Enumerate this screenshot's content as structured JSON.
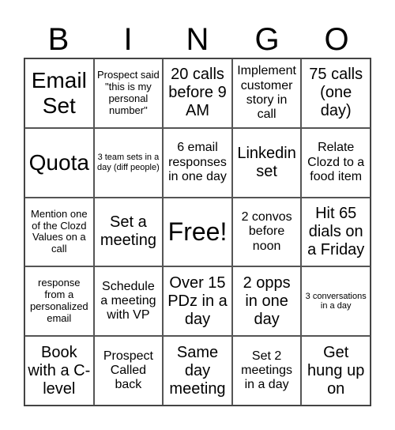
{
  "header": {
    "letters": [
      "B",
      "I",
      "N",
      "G",
      "O"
    ]
  },
  "cells": [
    {
      "text": "Email Set",
      "size": "xl"
    },
    {
      "text": "Prospect said \"this is my personal number\"",
      "size": "s"
    },
    {
      "text": "20 calls before 9 AM",
      "size": "l"
    },
    {
      "text": "Implement customer story in call",
      "size": "m"
    },
    {
      "text": "75 calls (one day)",
      "size": "l"
    },
    {
      "text": "Quota",
      "size": "xl"
    },
    {
      "text": "3 team sets in a day (diff people)",
      "size": "xs"
    },
    {
      "text": "6 email responses in one day",
      "size": "m"
    },
    {
      "text": "Linkedin set",
      "size": "l"
    },
    {
      "text": "Relate Clozd to a food item",
      "size": "m"
    },
    {
      "text": "Mention one of the Clozd Values on a call",
      "size": "s"
    },
    {
      "text": "Set a meeting",
      "size": "l"
    },
    {
      "text": "Free!",
      "size": "free"
    },
    {
      "text": "2 convos before noon",
      "size": "m"
    },
    {
      "text": "Hit 65 dials on a Friday",
      "size": "l"
    },
    {
      "text": "response from a personalized email",
      "size": "s"
    },
    {
      "text": "Schedule a meeting with VP",
      "size": "m"
    },
    {
      "text": "Over 15 PDz in a day",
      "size": "l"
    },
    {
      "text": "2 opps in one day",
      "size": "l"
    },
    {
      "text": "3 conversations in a day",
      "size": "xs"
    },
    {
      "text": "Book with a C-level",
      "size": "l"
    },
    {
      "text": "Prospect Called back",
      "size": "m"
    },
    {
      "text": "Same day meeting",
      "size": "l"
    },
    {
      "text": "Set 2 meetings in a day",
      "size": "m"
    },
    {
      "text": "Get hung up on",
      "size": "l"
    }
  ]
}
